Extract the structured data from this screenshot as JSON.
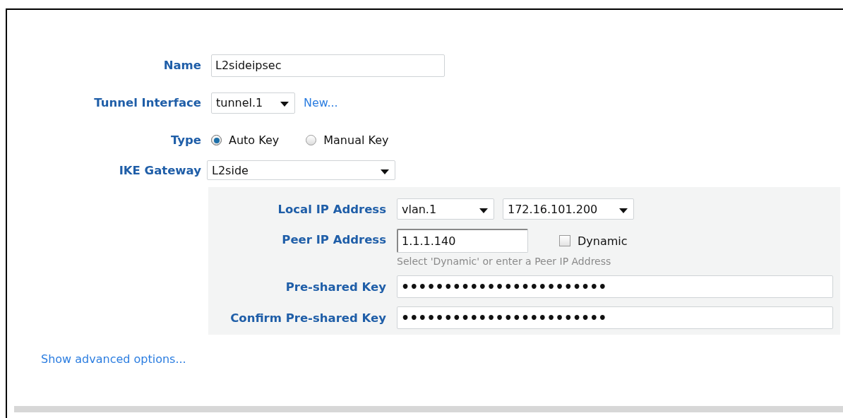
{
  "name": {
    "label": "Name",
    "value": "L2sideipsec"
  },
  "tunnel_interface": {
    "label": "Tunnel Interface",
    "value": "tunnel.1",
    "link": "New..."
  },
  "type": {
    "label": "Type",
    "options": [
      {
        "label": "Auto Key",
        "selected": true
      },
      {
        "label": "Manual Key",
        "selected": false
      }
    ]
  },
  "ike_gateway": {
    "label": "IKE Gateway",
    "value": "L2side"
  },
  "gateway_panel": {
    "local_ip": {
      "label": "Local IP Address",
      "interface": "vlan.1",
      "address": "172.16.101.200"
    },
    "peer_ip": {
      "label": "Peer IP Address",
      "value": "1.1.1.140",
      "dynamic": {
        "label": "Dynamic",
        "checked": false
      },
      "hint": "Select 'Dynamic' or enter a Peer IP Address"
    },
    "keys": [
      {
        "label": "Pre-shared Key",
        "value": "••••••••••••••••••••••••"
      },
      {
        "label": "Confirm Pre-shared Key",
        "value": "••••••••••••••••••••••••"
      }
    ]
  },
  "advanced_link": "Show advanced options..."
}
